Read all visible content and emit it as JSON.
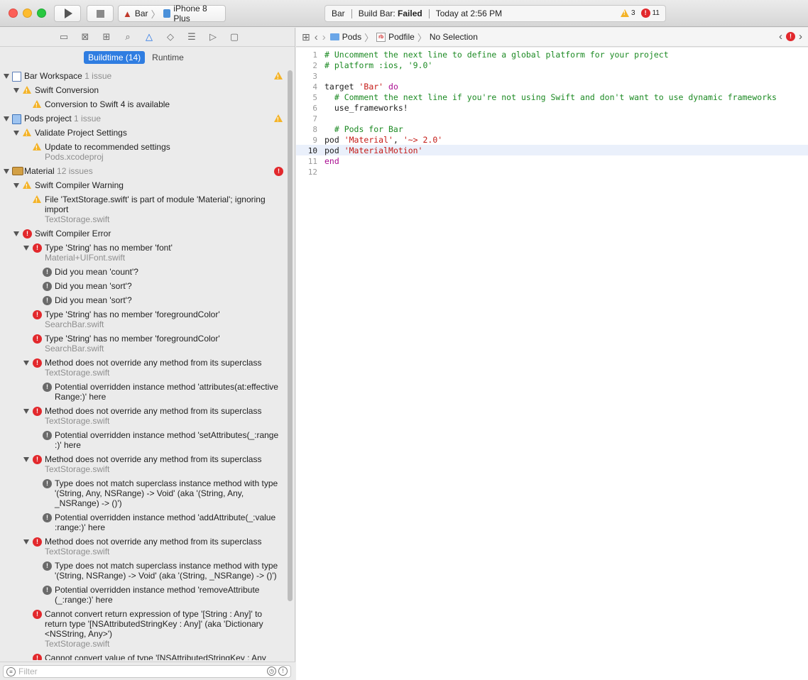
{
  "toolbar": {
    "scheme": {
      "target": "Bar",
      "destination": "iPhone 8 Plus"
    },
    "activity": {
      "project": "Bar",
      "status_prefix": "Build Bar: ",
      "status_result": "Failed",
      "time": "Today at 2:56 PM",
      "warning_count": "3",
      "error_count": "11"
    }
  },
  "navigator": {
    "tabs": [
      "folder-icon",
      "source-control-icon",
      "hierarchy-icon",
      "search-icon",
      "issue-icon",
      "test-icon",
      "debug-icon",
      "breakpoint-icon",
      "report-icon"
    ],
    "scope": {
      "buildtime": "Buildtime (14)",
      "runtime": "Runtime"
    },
    "filter_placeholder": "Filter",
    "rows": [
      {
        "level": 0,
        "type": "project",
        "icon": "project-icon",
        "title": "Bar Workspace",
        "count": "1 issue",
        "badge": "warning"
      },
      {
        "level": 1,
        "type": "warning",
        "title": "Swift Conversion"
      },
      {
        "level": 2,
        "type": "warning",
        "title": "Conversion to Swift 4 is available"
      },
      {
        "level": 0,
        "type": "project",
        "icon": "pods-project-icon",
        "title": "Pods project",
        "count": "1 issue",
        "badge": "warning"
      },
      {
        "level": 1,
        "type": "warning",
        "title": "Validate Project Settings"
      },
      {
        "level": 2,
        "type": "warning",
        "title": "Update to recommended settings",
        "sub": "Pods.xcodeproj"
      },
      {
        "level": 0,
        "type": "project",
        "icon": "framework-icon",
        "title": "Material",
        "count": "12 issues",
        "badge": "error"
      },
      {
        "level": 1,
        "type": "warning",
        "title": "Swift Compiler Warning"
      },
      {
        "level": 2,
        "type": "warning",
        "title": "File 'TextStorage.swift' is part of module 'Material'; ignoring",
        "title2": "import",
        "sub": "TextStorage.swift"
      },
      {
        "level": 1,
        "type": "error",
        "title": "Swift Compiler Error"
      },
      {
        "level": 2,
        "type": "error",
        "disclosure": true,
        "title": "Type 'String' has no member 'font'",
        "sub": "Material+UIFont.swift"
      },
      {
        "level": 3,
        "type": "note",
        "title": "Did you mean 'count'?"
      },
      {
        "level": 3,
        "type": "note",
        "title": "Did you mean 'sort'?"
      },
      {
        "level": 3,
        "type": "note",
        "title": "Did you mean 'sort'?"
      },
      {
        "level": 2,
        "type": "error",
        "title": "Type 'String' has no member 'foregroundColor'",
        "sub": "SearchBar.swift"
      },
      {
        "level": 2,
        "type": "error",
        "title": "Type 'String' has no member 'foregroundColor'",
        "sub": "SearchBar.swift"
      },
      {
        "level": 2,
        "type": "error",
        "disclosure": true,
        "title": "Method does not override any method from its superclass",
        "sub": "TextStorage.swift"
      },
      {
        "level": 3,
        "type": "note",
        "title": "Potential overridden instance method 'attributes(at:effective",
        "title2": "Range:)' here"
      },
      {
        "level": 2,
        "type": "error",
        "disclosure": true,
        "title": "Method does not override any method from its superclass",
        "sub": "TextStorage.swift"
      },
      {
        "level": 3,
        "type": "note",
        "title": "Potential overridden instance method 'setAttributes(_:range",
        "title2": ":)' here"
      },
      {
        "level": 2,
        "type": "error",
        "disclosure": true,
        "title": "Method does not override any method from its superclass",
        "sub": "TextStorage.swift"
      },
      {
        "level": 3,
        "type": "note",
        "title": "Type does not match superclass instance method with type",
        "title2": "'(String, Any, NSRange) -> Void' (aka '(String, Any,",
        "title3": "_NSRange) -> ()')"
      },
      {
        "level": 3,
        "type": "note",
        "title": "Potential overridden instance method 'addAttribute(_:value",
        "title2": ":range:)' here"
      },
      {
        "level": 2,
        "type": "error",
        "disclosure": true,
        "title": "Method does not override any method from its superclass",
        "sub": "TextStorage.swift"
      },
      {
        "level": 3,
        "type": "note",
        "title": "Type does not match superclass instance method with type",
        "title2": "'(String, NSRange) -> Void' (aka '(String, _NSRange) -> ()')"
      },
      {
        "level": 3,
        "type": "note",
        "title": "Potential overridden instance method 'removeAttribute",
        "title2": "(_:range:)' here"
      },
      {
        "level": 2,
        "type": "error",
        "title": "Cannot convert return expression of type '[String : Any]' to",
        "title2": "return type '[NSAttributedStringKey : Any]' (aka 'Dictionary",
        "title3": "<NSString, Any>')",
        "sub": "TextStorage.swift"
      },
      {
        "level": 2,
        "type": "error",
        "title": "Cannot convert value of type '[NSAttributedStringKey : Any"
      }
    ]
  },
  "jumpbar": {
    "crumbs": [
      "Pods",
      "Podfile",
      "No Selection"
    ]
  },
  "editor": {
    "current_line": 10,
    "lines": [
      {
        "n": "1",
        "text": "# Uncomment the next line to define a global platform for your project"
      },
      {
        "n": "2",
        "text": "# platform :ios, '9.0'"
      },
      {
        "n": "3",
        "text": ""
      },
      {
        "n": "4",
        "text": "target 'Bar' do"
      },
      {
        "n": "5",
        "text": "  # Comment the next line if you're not using Swift and don't want to use dynamic frameworks"
      },
      {
        "n": "6",
        "text": "  use_frameworks!"
      },
      {
        "n": "7",
        "text": ""
      },
      {
        "n": "8",
        "text": "  # Pods for Bar"
      },
      {
        "n": "9",
        "text": "pod 'Material', '~> 2.0'"
      },
      {
        "n": "10",
        "text": "pod 'MaterialMotion'"
      },
      {
        "n": "11",
        "text": "end"
      },
      {
        "n": "12",
        "text": ""
      }
    ]
  },
  "colors": {
    "accent": "#2f7de1",
    "error": "#e2282c",
    "warning": "#f4b328",
    "comment": "#1c8a23",
    "string": "#c41a16",
    "keyword": "#aa0d91"
  }
}
